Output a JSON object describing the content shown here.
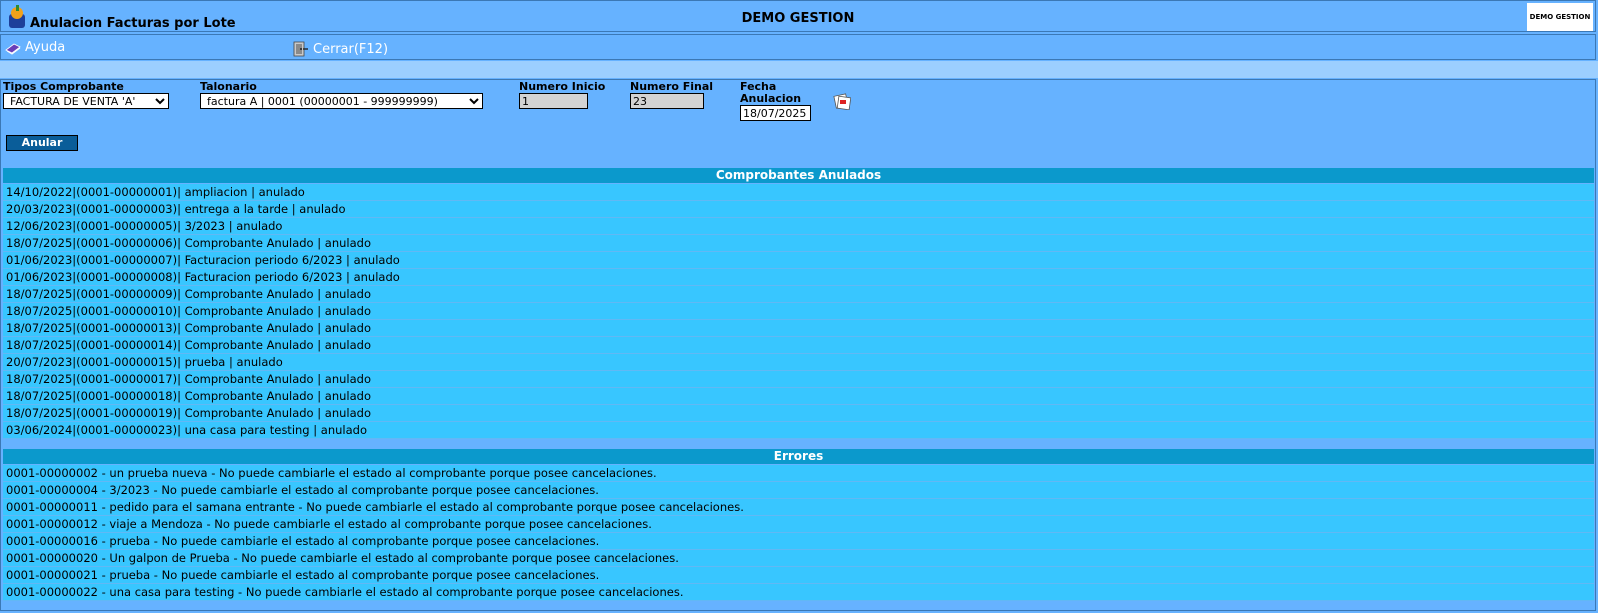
{
  "window": {
    "title": "Anulacion Facturas por Lote",
    "company": "DEMO GESTION",
    "logo_text": "DEMO GESTION"
  },
  "menu": {
    "ayuda": "Ayuda",
    "cerrar": "Cerrar(F12)"
  },
  "form": {
    "tipos_label": "Tipos Comprobante",
    "tipos_value": "FACTURA DE VENTA 'A'",
    "talonario_label": "Talonario",
    "talonario_value": "factura A | 0001 (00000001 - 999999999)",
    "inicio_label": "Numero Inicio",
    "inicio_value": "1",
    "final_label": "Numero Final",
    "final_value": "23",
    "fecha_label_1": "Fecha",
    "fecha_label_2": "Anulacion",
    "fecha_value": "18/07/2025",
    "anular_button": "Anular"
  },
  "anulados": {
    "header": "Comprobantes Anulados",
    "rows": [
      "14/10/2022|(0001-00000001)| ampliacion | anulado",
      "20/03/2023|(0001-00000003)| entrega a la tarde | anulado",
      "12/06/2023|(0001-00000005)| 3/2023 | anulado",
      "18/07/2025|(0001-00000006)| Comprobante Anulado | anulado",
      "01/06/2023|(0001-00000007)| Facturacion periodo 6/2023 | anulado",
      "01/06/2023|(0001-00000008)| Facturacion periodo 6/2023 | anulado",
      "18/07/2025|(0001-00000009)| Comprobante Anulado | anulado",
      "18/07/2025|(0001-00000010)| Comprobante Anulado | anulado",
      "18/07/2025|(0001-00000013)| Comprobante Anulado | anulado",
      "18/07/2025|(0001-00000014)| Comprobante Anulado | anulado",
      "20/07/2023|(0001-00000015)| prueba | anulado",
      "18/07/2025|(0001-00000017)| Comprobante Anulado | anulado",
      "18/07/2025|(0001-00000018)| Comprobante Anulado | anulado",
      "18/07/2025|(0001-00000019)| Comprobante Anulado | anulado",
      "03/06/2024|(0001-00000023)| una casa para testing | anulado"
    ]
  },
  "errores": {
    "header": "Errores",
    "rows": [
      "0001-00000002 - un prueba nueva - No puede cambiarle el estado al comprobante porque posee cancelaciones.",
      "0001-00000004 - 3/2023 - No puede cambiarle el estado al comprobante porque posee cancelaciones.",
      "0001-00000011 - pedido para el samana entrante - No puede cambiarle el estado al comprobante porque posee cancelaciones.",
      "0001-00000012 - viaje a Mendoza - No puede cambiarle el estado al comprobante porque posee cancelaciones.",
      "0001-00000016 - prueba - No puede cambiarle el estado al comprobante porque posee cancelaciones.",
      "0001-00000020 - Un galpon de Prueba - No puede cambiarle el estado al comprobante porque posee cancelaciones.",
      "0001-00000021 - prueba - No puede cambiarle el estado al comprobante porque posee cancelaciones.",
      "0001-00000022 - una casa para testing - No puede cambiarle el estado al comprobante porque posee cancelaciones."
    ]
  }
}
